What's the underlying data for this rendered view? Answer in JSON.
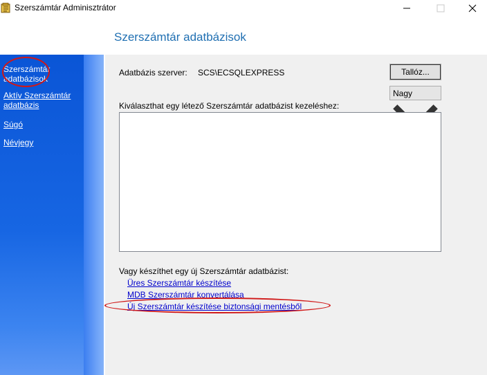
{
  "window": {
    "title": "Szerszámtár Adminisztrátor",
    "minimize_icon": "minimize-icon",
    "maximize_icon": "maximize-icon",
    "close_icon": "close-icon"
  },
  "page": {
    "title": "Szerszámtár adatbázisok"
  },
  "sidebar": {
    "items": [
      {
        "label_line1": "Szerszámtár",
        "label_line2": "adatbázisok",
        "current": true
      },
      {
        "label_line1": "Aktív Szerszámtár",
        "label_line2": "adatbázis"
      },
      {
        "label_line1": "Súgó"
      },
      {
        "label_line1": "Névjegy"
      }
    ]
  },
  "main": {
    "server_label": "Adatbázis szerver:",
    "server_value": "SCS\\ECSQLEXPRESS",
    "browse_button": "Tallóz...",
    "size_select": {
      "value": "Nagy"
    },
    "list_prompt": "Kiválaszthat egy létező Szerszámtár adatbázist kezeléshez:",
    "list_items": [],
    "create_prompt": "Vagy készíthet egy új Szerszámtár adatbázist:",
    "actions": [
      "Üres Szerszámtár készítése",
      "MDB Szerszámtár konvertálása",
      "Új Szerszámtár készítése biztonsági mentésből"
    ]
  },
  "annotations_color": "#d01818"
}
